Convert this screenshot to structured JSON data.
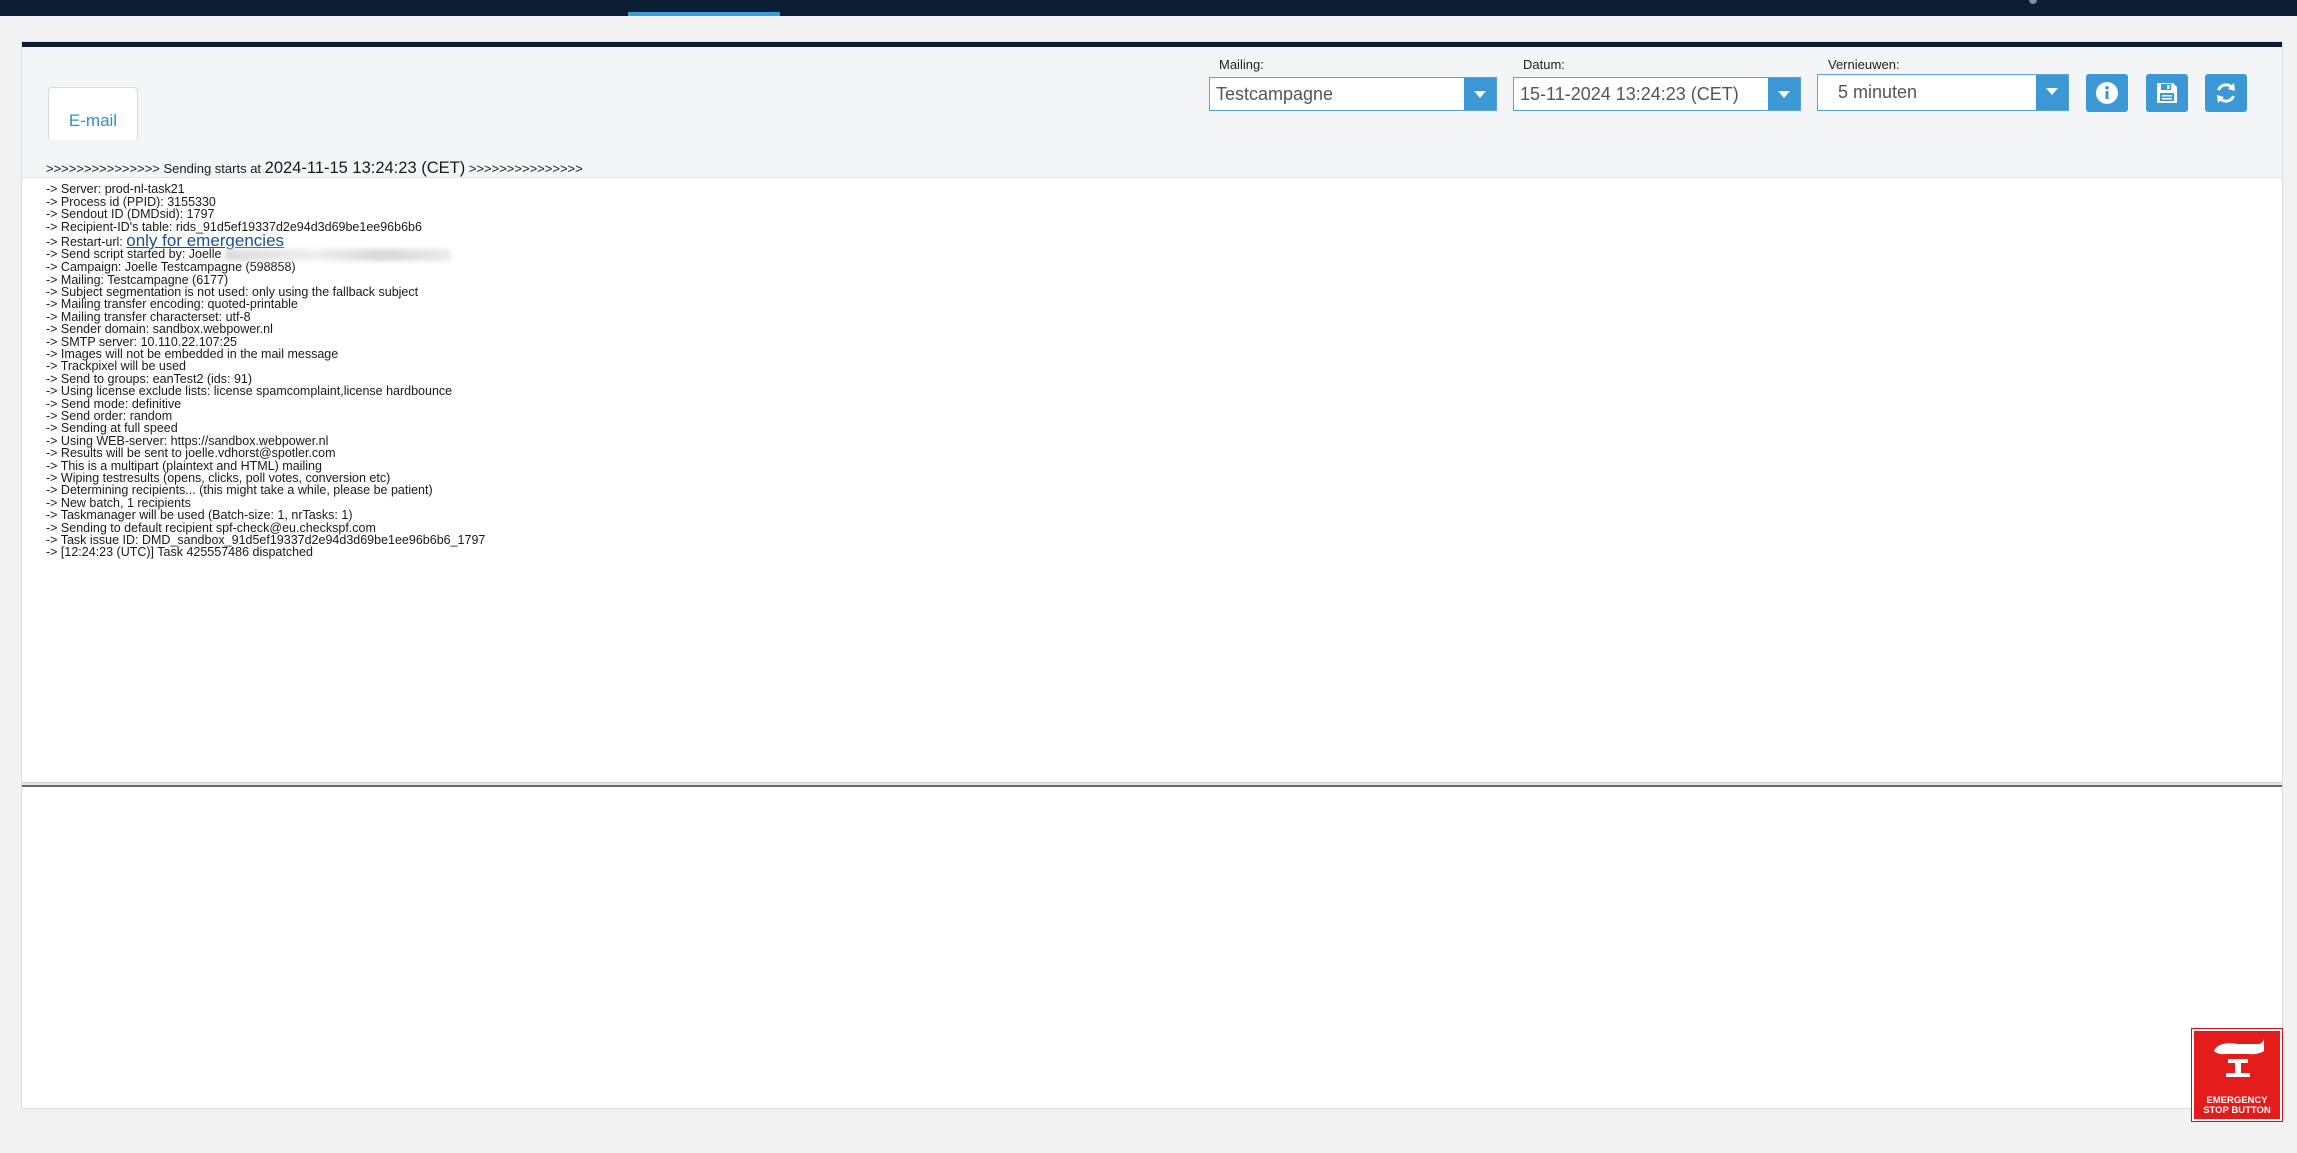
{
  "toolbar": {
    "tab_email": "E-mail",
    "mailing": {
      "label": "Mailing:",
      "value": "Testcampagne"
    },
    "datum": {
      "label": "Datum:",
      "value": "15-11-2024 13:24:23 (CET)"
    },
    "vernieuwen": {
      "label": "Vernieuwen:",
      "value": "5 minuten"
    },
    "icons": [
      "info-icon",
      "save-icon",
      "refresh-icon"
    ]
  },
  "log": {
    "start_prefix": ">>>>>>>>>>>>>>> Sending starts at ",
    "start_time": "2024-11-15 13:24:23 (CET)",
    "start_suffix": " >>>>>>>>>>>>>>>",
    "server": "-> Server: prod-nl-task21",
    "process_id": "-> Process id (PPID): 3155330",
    "sendout_id": "-> Sendout ID (DMDsid): 1797",
    "recipient_table": "-> Recipient-ID's table: rids_91d5ef19337d2e94d3d69be1ee96b6b6",
    "restart_prefix": "-> Restart-url: ",
    "restart_link": "only for emergencies",
    "started_by": "-> Send script started by: Joelle",
    "lines_after": [
      "-> Campaign: Joelle Testcampagne (598858)",
      "-> Mailing: Testcampagne (6177)",
      "-> Subject segmentation is not used: only using the fallback subject",
      "-> Mailing transfer encoding: quoted-printable",
      "-> Mailing transfer characterset: utf-8",
      "-> Sender domain: sandbox.webpower.nl",
      "-> SMTP server: 10.110.22.107:25",
      "-> Images will not be embedded in the mail message",
      "-> Trackpixel will be used",
      "-> Send to groups: eanTest2 (ids: 91)",
      "-> Using license exclude lists: license spamcomplaint,license hardbounce",
      "-> Send mode: definitive",
      "-> Send order: random",
      "-> Sending at full speed",
      "-> Using WEB-server: https://sandbox.webpower.nl",
      "-> Results will be sent to joelle.vdhorst@spotler.com",
      "-> This is a multipart (plaintext and HTML) mailing",
      "-> Wiping testresults (opens, clicks, poll votes, conversion etc)",
      "-> Determining recipients... (this might take a while, please be patient)",
      "-> New batch, 1 recipients",
      "-> Taskmanager will be used (Batch-size: 1, nrTasks: 1)",
      "-> Sending to default recipient spf-check@eu.checkspf.com",
      "-> Task issue ID: DMD_sandbox_91d5ef19337d2e94d3d69be1ee96b6b6_1797",
      "-> [12:24:23 (UTC)] Task 425557486 dispatched"
    ]
  },
  "emergency": {
    "line1": "EMERGENCY",
    "line2": "STOP BUTTON"
  },
  "colors": {
    "accent": "#3b98d4",
    "navy": "#0b1e33",
    "emergency": "#e31b1b",
    "link": "#1a4f94"
  }
}
